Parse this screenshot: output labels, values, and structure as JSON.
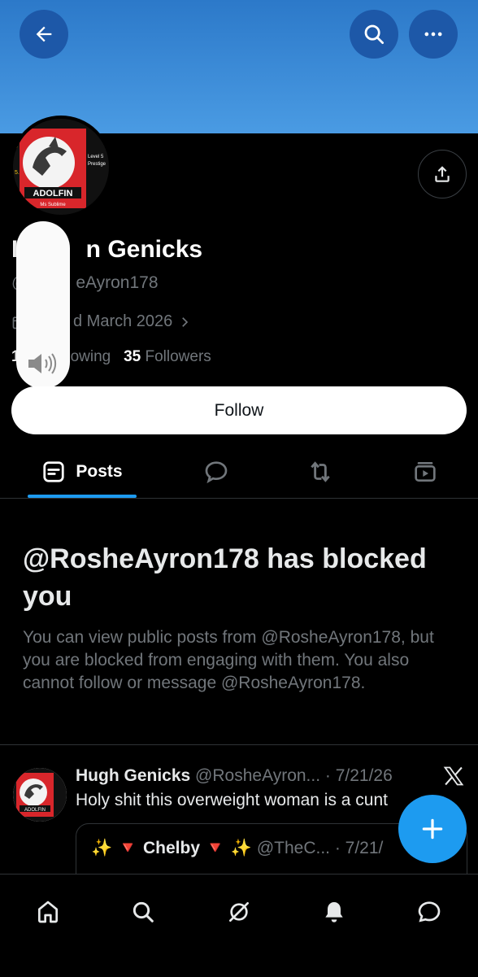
{
  "profile": {
    "name_visible_left": "H",
    "name_visible_right": "n Genicks",
    "handle_visible_left": "@",
    "handle_visible_right": "eAyron178",
    "joined_visible": "d March 2026",
    "following_count_visible": "1",
    "following_label_visible": "owing",
    "followers_count": "35",
    "followers_label": "Followers",
    "avatar_texts": [
      "4",
      "5.",
      "Level 5",
      "Prestige",
      "ADOLFIN",
      "Ms Sublime"
    ]
  },
  "follow_button": {
    "label": "Follow"
  },
  "tabs": [
    {
      "label": "Posts",
      "active": true,
      "icon": "list-icon"
    },
    {
      "icon": "reply-icon"
    },
    {
      "icon": "repost-icon"
    },
    {
      "icon": "media-icon"
    }
  ],
  "blocked": {
    "title": "@RosheAyron178 has blocked you",
    "body": "You can view public posts from @RosheAyron178, but you are blocked from engaging with them. You also cannot follow or message @RosheAyron178."
  },
  "post": {
    "author": "Hugh Genicks",
    "handle_date": "@RosheAyron... · 7/21/26",
    "text": "Holy shit this overweight woman is a cunt",
    "quote": {
      "prefix_emoji": "✨ 🔻",
      "author": "Chelby",
      "suffix_emoji": "🔻 ✨",
      "handle_date": "@TheC... · 7/21/"
    }
  },
  "colors": {
    "banner": "#4a9be3",
    "accent": "#1d9bf0",
    "background": "#000000",
    "secondary_text": "#71767b"
  },
  "nav_icons": [
    "home-icon",
    "search-icon",
    "grok-icon",
    "notifications-icon",
    "messages-icon"
  ],
  "watermark": "X"
}
